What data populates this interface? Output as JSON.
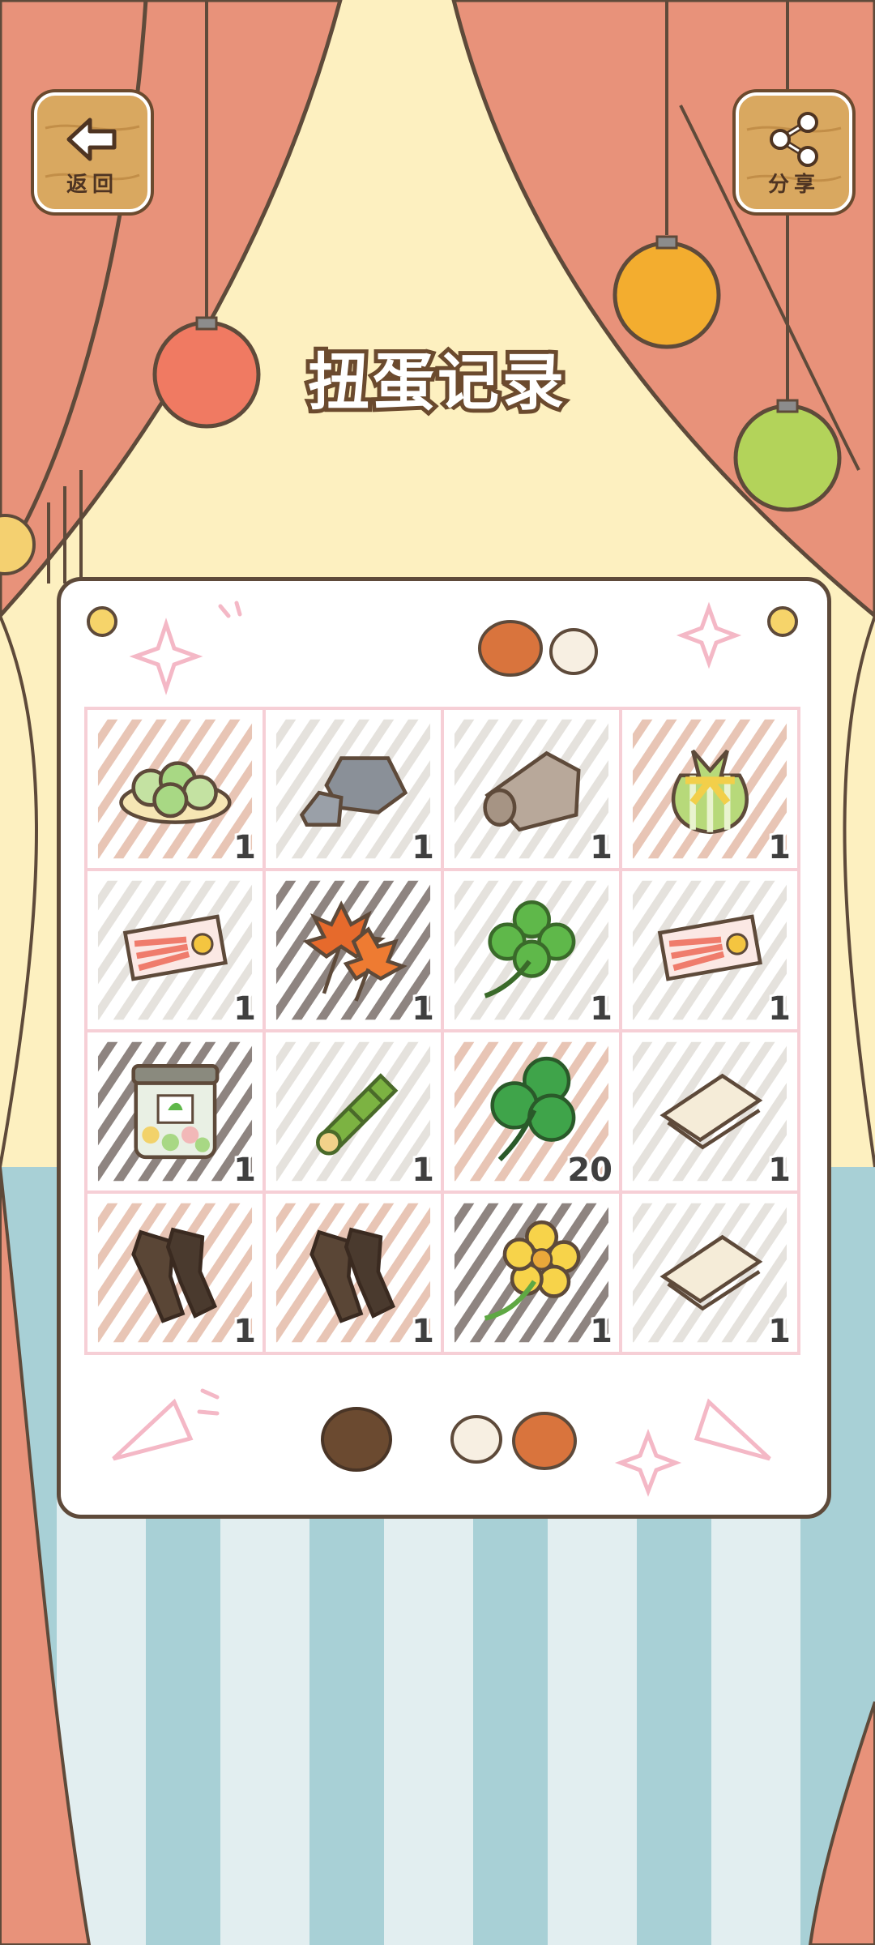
{
  "title": "扭蛋记录",
  "buttons": {
    "back": {
      "label": "返回",
      "icon": "back-arrow-icon"
    },
    "share": {
      "label": "分享",
      "icon": "share-icon"
    }
  },
  "items": [
    {
      "name": "cabbage-dumplings",
      "count": "1"
    },
    {
      "name": "gray-stone",
      "count": "1"
    },
    {
      "name": "rolled-cloth",
      "count": "1"
    },
    {
      "name": "striped-lucky-bag",
      "count": "1"
    },
    {
      "name": "sunrise-card",
      "count": "1"
    },
    {
      "name": "maple-leaves",
      "count": "1"
    },
    {
      "name": "four-leaf-clover",
      "count": "1"
    },
    {
      "name": "sunrise-card",
      "count": "1"
    },
    {
      "name": "candy-jar",
      "count": "1"
    },
    {
      "name": "bamboo-tube",
      "count": "1"
    },
    {
      "name": "three-leaf-clover",
      "count": "20"
    },
    {
      "name": "folded-paper",
      "count": "1"
    },
    {
      "name": "bark-pieces",
      "count": "1"
    },
    {
      "name": "bark-pieces",
      "count": "1"
    },
    {
      "name": "yellow-flower",
      "count": "1"
    },
    {
      "name": "folded-paper",
      "count": "1"
    }
  ],
  "colors": {
    "curtain": "#e8927a",
    "backdrop": "#fdf0c0",
    "floor_light": "#e2eef0",
    "floor_dark": "#a8d0d6",
    "button_wood": "#d9a860",
    "outline": "#5e4a3a"
  }
}
